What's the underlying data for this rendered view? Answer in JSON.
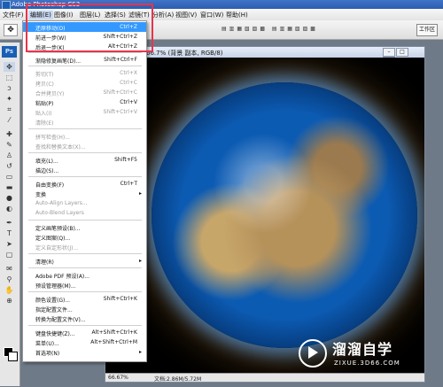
{
  "app": {
    "title": "Adobe Photoshop CS3"
  },
  "menubar": {
    "file": "文件(F)",
    "edit": "编辑(E)",
    "image": "图像(I)",
    "layer": "图层(L)",
    "select": "选择(S)",
    "filter": "滤镜(T)",
    "analysis": "分析(A)",
    "view": "视图(V)",
    "window": "窗口(W)",
    "help": "帮助(H)"
  },
  "options": {
    "workspace": "工作区"
  },
  "document": {
    "title": "66.7% (背景 副本, RGB/8)",
    "zoom": "66.67%",
    "file_info": "文档:2.86M/5.72M"
  },
  "watermark": {
    "name": "溜溜自学",
    "url": "ZIXUE.3D66.COM"
  },
  "edit_menu": {
    "undo": {
      "label": "还原移动(O)",
      "shortcut": "Ctrl+Z"
    },
    "step_forward": {
      "label": "前进一步(W)",
      "shortcut": "Shift+Ctrl+Z"
    },
    "step_backward": {
      "label": "后退一步(K)",
      "shortcut": "Alt+Ctrl+Z"
    },
    "fade": {
      "label": "渐隐修复画笔(D)...",
      "shortcut": "Shift+Ctrl+F"
    },
    "cut": {
      "label": "剪切(T)",
      "shortcut": "Ctrl+X"
    },
    "copy": {
      "label": "拷贝(C)",
      "shortcut": "Ctrl+C"
    },
    "copy_merged": {
      "label": "合并拷贝(Y)",
      "shortcut": "Shift+Ctrl+C"
    },
    "paste": {
      "label": "粘贴(P)",
      "shortcut": "Ctrl+V"
    },
    "paste_into": {
      "label": "贴入(I)",
      "shortcut": "Shift+Ctrl+V"
    },
    "clear": {
      "label": "清除(E)"
    },
    "check_spelling": {
      "label": "拼写检查(H)..."
    },
    "find_replace": {
      "label": "查找和替换文本(X)..."
    },
    "fill": {
      "label": "填充(L)...",
      "shortcut": "Shift+F5"
    },
    "stroke": {
      "label": "描边(S)..."
    },
    "free_transform": {
      "label": "自由变换(F)",
      "shortcut": "Ctrl+T"
    },
    "transform": {
      "label": "变换"
    },
    "auto_align": {
      "label": "Auto-Align Layers..."
    },
    "auto_blend": {
      "label": "Auto-Blend Layers"
    },
    "define_brush": {
      "label": "定义画笔预设(B)..."
    },
    "define_pattern": {
      "label": "定义图案(Q)..."
    },
    "define_shape": {
      "label": "定义自定形状(J)..."
    },
    "purge": {
      "label": "清理(R)"
    },
    "pdf_presets": {
      "label": "Adobe PDF 预设(A)..."
    },
    "preset_manager": {
      "label": "预设管理器(M)..."
    },
    "color_settings": {
      "label": "颜色设置(G)...",
      "shortcut": "Shift+Ctrl+K"
    },
    "assign_profile": {
      "label": "指定配置文件..."
    },
    "convert_profile": {
      "label": "转换为配置文件(V)..."
    },
    "keyboard_shortcuts": {
      "label": "键盘快捷键(Z)...",
      "shortcut": "Alt+Shift+Ctrl+K"
    },
    "menus": {
      "label": "菜单(U)...",
      "shortcut": "Alt+Shift+Ctrl+M"
    },
    "preferences": {
      "label": "首选项(N)"
    }
  },
  "colors": {
    "highlight": "#3399ff",
    "annotation": "#e8344c"
  },
  "icons": [
    "move-icon",
    "marquee-icon",
    "lasso-icon",
    "magic-wand-icon",
    "crop-icon",
    "slice-icon",
    "heal-icon",
    "brush-icon",
    "stamp-icon",
    "history-brush-icon",
    "eraser-icon",
    "gradient-icon",
    "blur-icon",
    "dodge-icon",
    "pen-icon",
    "type-icon",
    "path-select-icon",
    "shape-icon",
    "notes-icon",
    "eyedropper-icon",
    "hand-icon",
    "zoom-icon"
  ]
}
